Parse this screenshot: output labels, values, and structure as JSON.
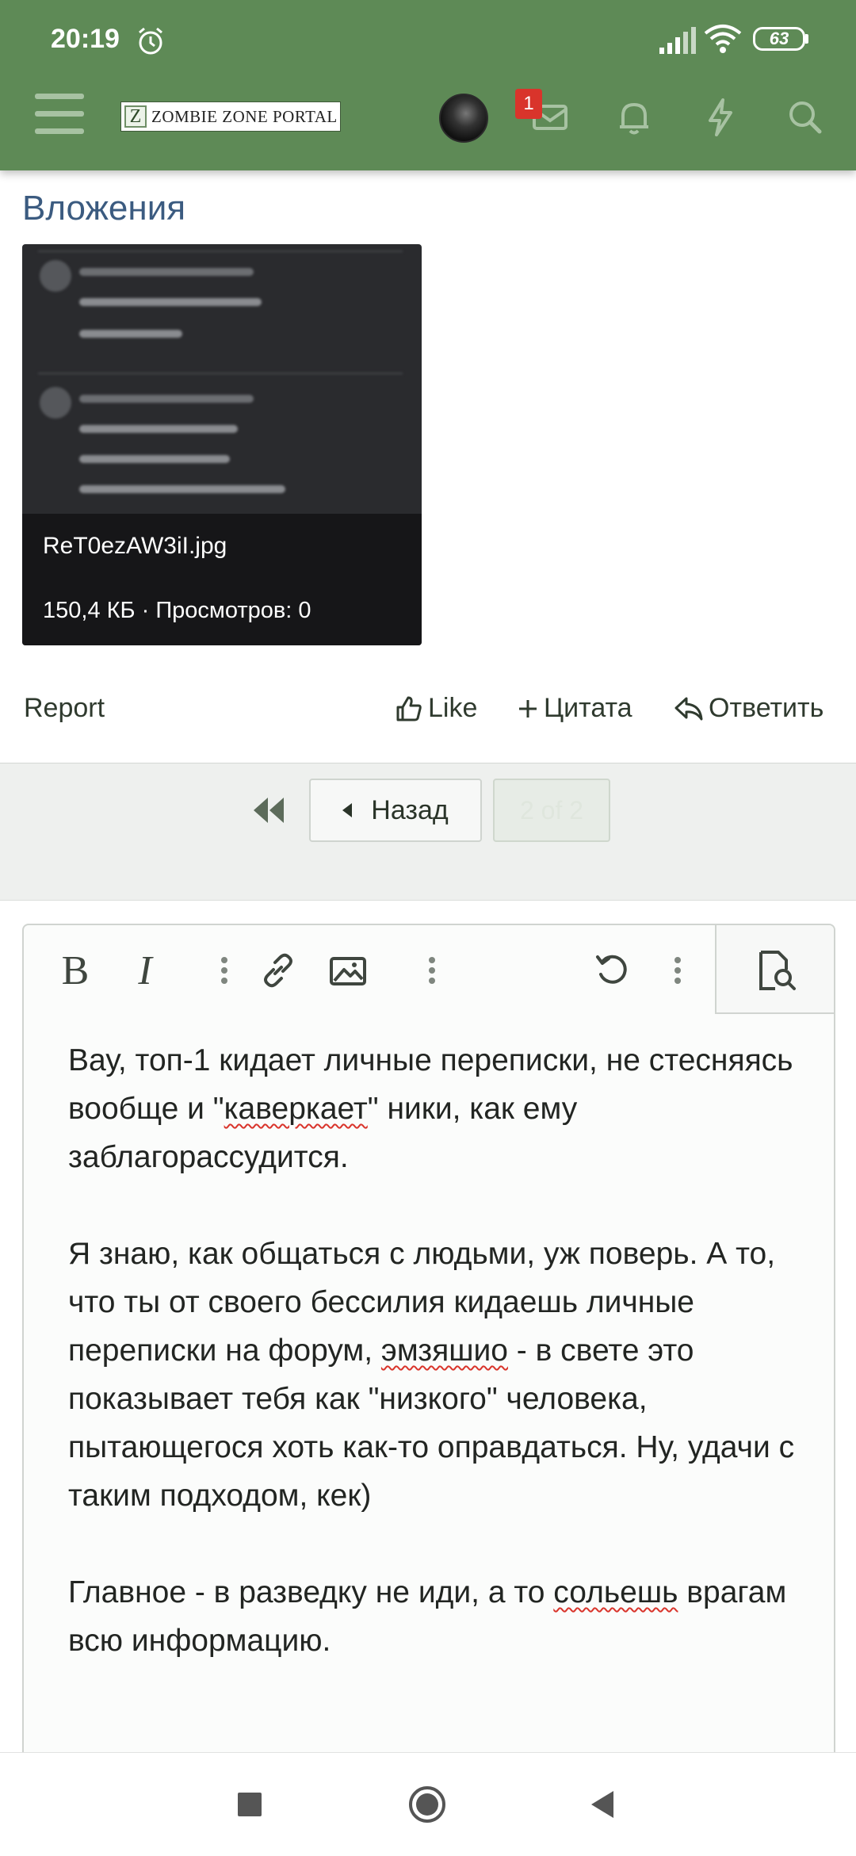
{
  "status_bar": {
    "time": "20:19",
    "battery": "63"
  },
  "header": {
    "logo_letter": "Z",
    "logo_text": "ZOMBIE ZONE PORTAL",
    "inbox_badge": "1"
  },
  "attachments": {
    "title": "Вложения",
    "file_name": "ReT0ezAW3iI.jpg",
    "file_meta": "150,4 КБ · Просмотров: 0"
  },
  "post_actions": {
    "report": "Report",
    "like": "Like",
    "quote": "Цитата",
    "reply": "Ответить"
  },
  "pagination": {
    "back_label": "Назад",
    "page_label": "2 of 2"
  },
  "editor": {
    "p1_a": "Вау, топ-1 кидает личные переписки, не стесняясь вообще и \"",
    "p1_word": "каверкает",
    "p1_b": "\" ники, как ему заблагорассудится.",
    "p2_a": "Я знаю, как общаться с людьми, уж поверь. А то, что ты от своего бессилия кидаешь личные переписки на форум, ",
    "p2_word": "эмзяшио",
    "p2_b": " - в свете это показывает тебя как \"низкого\" человека, пытающегося хоть как-то оправдаться. Ну, удачи с таким подходом, кек)",
    "p3_a": "Главное - в разведку не иди, а то ",
    "p3_word": "сольешь",
    "p3_b": " врагам всю информацию."
  },
  "colors": {
    "header_bg": "#5e8a56",
    "title_blue": "#3b5b80",
    "badge_red": "#d9342b"
  }
}
